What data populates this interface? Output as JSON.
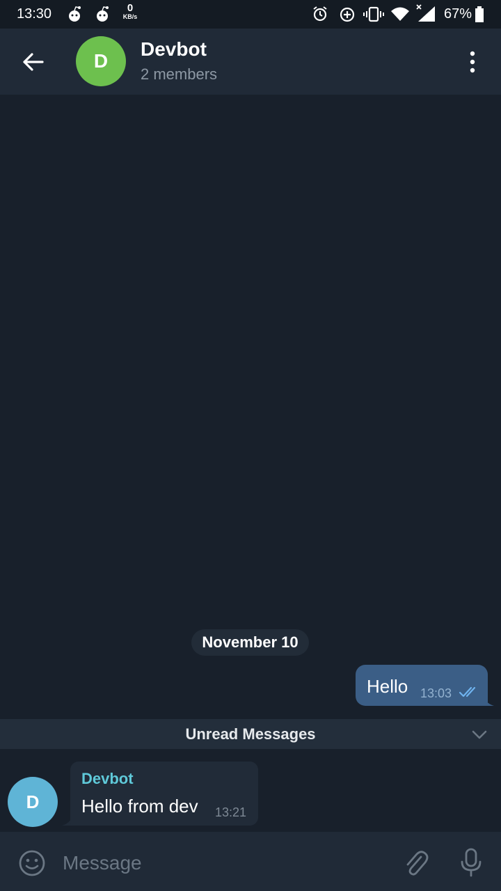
{
  "status_bar": {
    "time": "13:30",
    "net_speed_value": "0",
    "net_speed_unit": "KB/s",
    "battery": "67%"
  },
  "header": {
    "avatar_letter": "D",
    "title": "Devbot",
    "subtitle": "2 members"
  },
  "chat": {
    "date_label": "November 10",
    "outgoing": {
      "text": "Hello",
      "time": "13:03"
    },
    "unread_label": "Unread Messages",
    "incoming": {
      "avatar_letter": "D",
      "sender": "Devbot",
      "text": "Hello from dev",
      "time": "13:21"
    }
  },
  "composer": {
    "placeholder": "Message"
  },
  "colors": {
    "background": "#18202b",
    "header": "#202a37",
    "outgoing_bubble": "#3b5e86",
    "incoming_bubble": "#212b38",
    "sender_name": "#5fc9d9",
    "header_avatar": "#6dc04e",
    "message_avatar": "#5fb4d6"
  }
}
